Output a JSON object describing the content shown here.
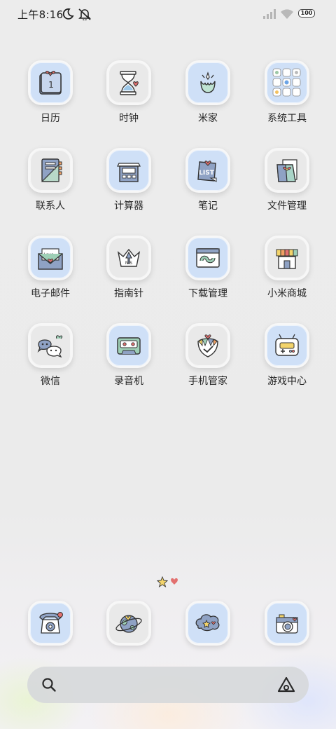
{
  "status_bar": {
    "time": "上午8:16",
    "battery": "100",
    "icons": [
      "moon-icon",
      "bell-muted-icon",
      "signal-icon",
      "wifi-icon",
      "battery-icon"
    ]
  },
  "apps": [
    {
      "label": "日历",
      "icon": "calendar-icon",
      "date": "1"
    },
    {
      "label": "时钟",
      "icon": "hourglass-icon"
    },
    {
      "label": "米家",
      "icon": "mijia-icon"
    },
    {
      "label": "系统工具",
      "icon": "folder-grid-icon"
    },
    {
      "label": "联系人",
      "icon": "contacts-book-icon"
    },
    {
      "label": "计算器",
      "icon": "calculator-icon"
    },
    {
      "label": "笔记",
      "icon": "notes-list-icon",
      "note_text": "LIST"
    },
    {
      "label": "文件管理",
      "icon": "file-folder-icon"
    },
    {
      "label": "电子邮件",
      "icon": "envelope-icon",
      "note_text": "Love~"
    },
    {
      "label": "指南针",
      "icon": "compass-crown-icon",
      "compass_text": "N S"
    },
    {
      "label": "下载管理",
      "icon": "download-window-icon"
    },
    {
      "label": "小米商城",
      "icon": "shop-icon"
    },
    {
      "label": "微信",
      "icon": "chat-bubbles-icon"
    },
    {
      "label": "录音机",
      "icon": "cassette-icon"
    },
    {
      "label": "手机管家",
      "icon": "shield-icon"
    },
    {
      "label": "游戏中心",
      "icon": "gamepad-icon"
    }
  ],
  "dock": [
    {
      "name": "phone",
      "icon": "telephone-icon"
    },
    {
      "name": "browser",
      "icon": "planet-icon"
    },
    {
      "name": "messages",
      "icon": "cloud-bubble-icon"
    },
    {
      "name": "camera",
      "icon": "camera-icon"
    }
  ],
  "search_bar": {
    "left_icon": "search-icon",
    "right_icon": "assistant-icon"
  },
  "page_indicator": [
    "star-icon",
    "heart-icon"
  ],
  "colors": {
    "tile_blue": "#cfe0f7",
    "tile_grey": "#e9e9e9",
    "background": "#ececec",
    "heart": "#e2706f",
    "star": "#f3d46b"
  }
}
